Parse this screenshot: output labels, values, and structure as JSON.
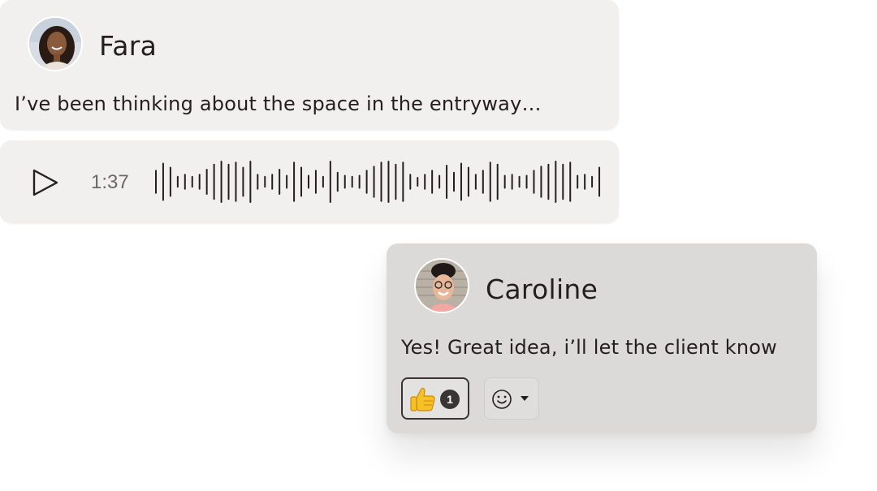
{
  "messages": [
    {
      "author": "Fara",
      "text": "I’ve been thinking about the space in the entryway…",
      "avatar_icon": "person-avatar-icon"
    },
    {
      "author": "Caroline",
      "text": "Yes! Great idea, i’ll let the client know",
      "avatar_icon": "person-avatar-icon",
      "reactions": [
        {
          "emoji": "thumbs-up-icon",
          "count": "1"
        }
      ]
    }
  ],
  "audio": {
    "duration": "1:37",
    "play_icon": "play-icon"
  },
  "colors": {
    "bubble_light": "#f1f0ef",
    "bubble_dark": "#dcdad9",
    "text": "#231f20",
    "badge": "#3a3435"
  }
}
